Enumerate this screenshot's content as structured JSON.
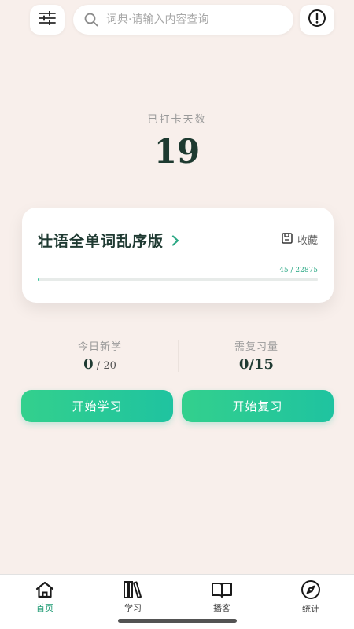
{
  "search": {
    "placeholder": "词典·请输入内容查询"
  },
  "streak": {
    "label": "已打卡天数",
    "value": "19"
  },
  "book": {
    "title": "壮语全单词乱序版",
    "collect_label": "收藏",
    "progress_text": "45 / 22875",
    "learned": 45,
    "total": 22875
  },
  "stats": {
    "new_label": "今日新学",
    "new_done": "0",
    "new_sep_goal": " / 20",
    "review_label": "需复习量",
    "review_value": "0/15"
  },
  "actions": {
    "start_learning": "开始学习",
    "start_review": "开始复习"
  },
  "nav": {
    "items": [
      {
        "label": "首页",
        "icon": "home-icon",
        "active": true
      },
      {
        "label": "学习",
        "icon": "books-icon",
        "active": false
      },
      {
        "label": "播客",
        "icon": "open-book-icon",
        "active": false
      },
      {
        "label": "统计",
        "icon": "compass-icon",
        "active": false
      }
    ]
  },
  "colors": {
    "background": "#f8efeb",
    "accent": "#2bc69a",
    "accent_text": "#1f9b74",
    "button_gradient_start": "#33d08d",
    "button_gradient_end": "#1fc3a0"
  }
}
